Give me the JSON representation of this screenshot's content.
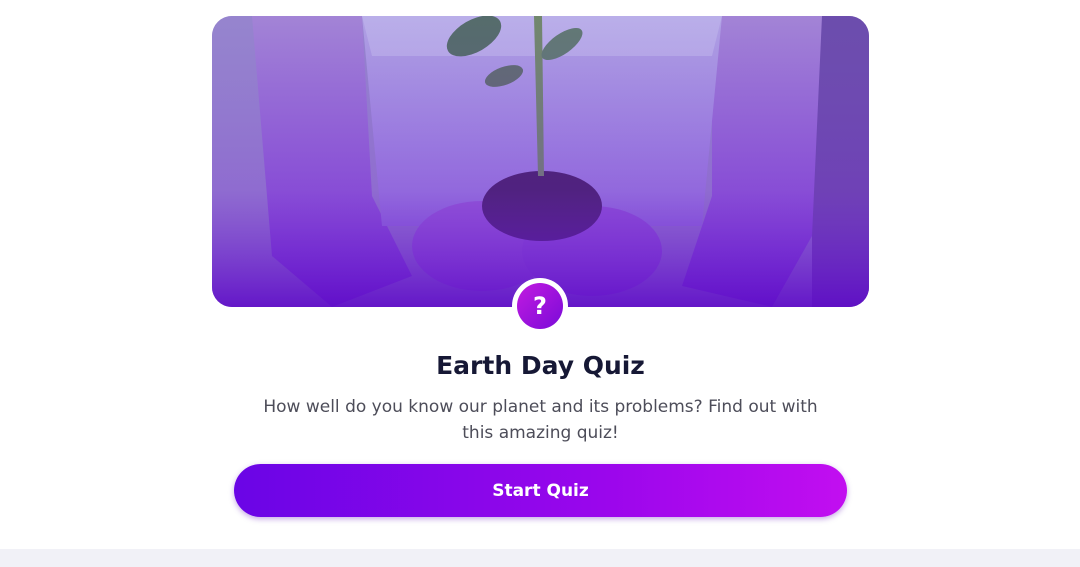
{
  "quiz_card": {
    "title": "Earth Day Quiz",
    "description": "How well do you know our planet and its problems? Find out with this amazing quiz!",
    "start_button_label": "Start Quiz",
    "badge_symbol": "?",
    "hero_image": "hands-holding-seedling-image",
    "badge_icon": "question-mark-icon"
  },
  "colors": {
    "accent_start": "#6a05e6",
    "accent_end": "#c20ef0",
    "title_color": "#161835",
    "text_color": "#4d4d59",
    "footer_bg": "#f1f1f7"
  }
}
